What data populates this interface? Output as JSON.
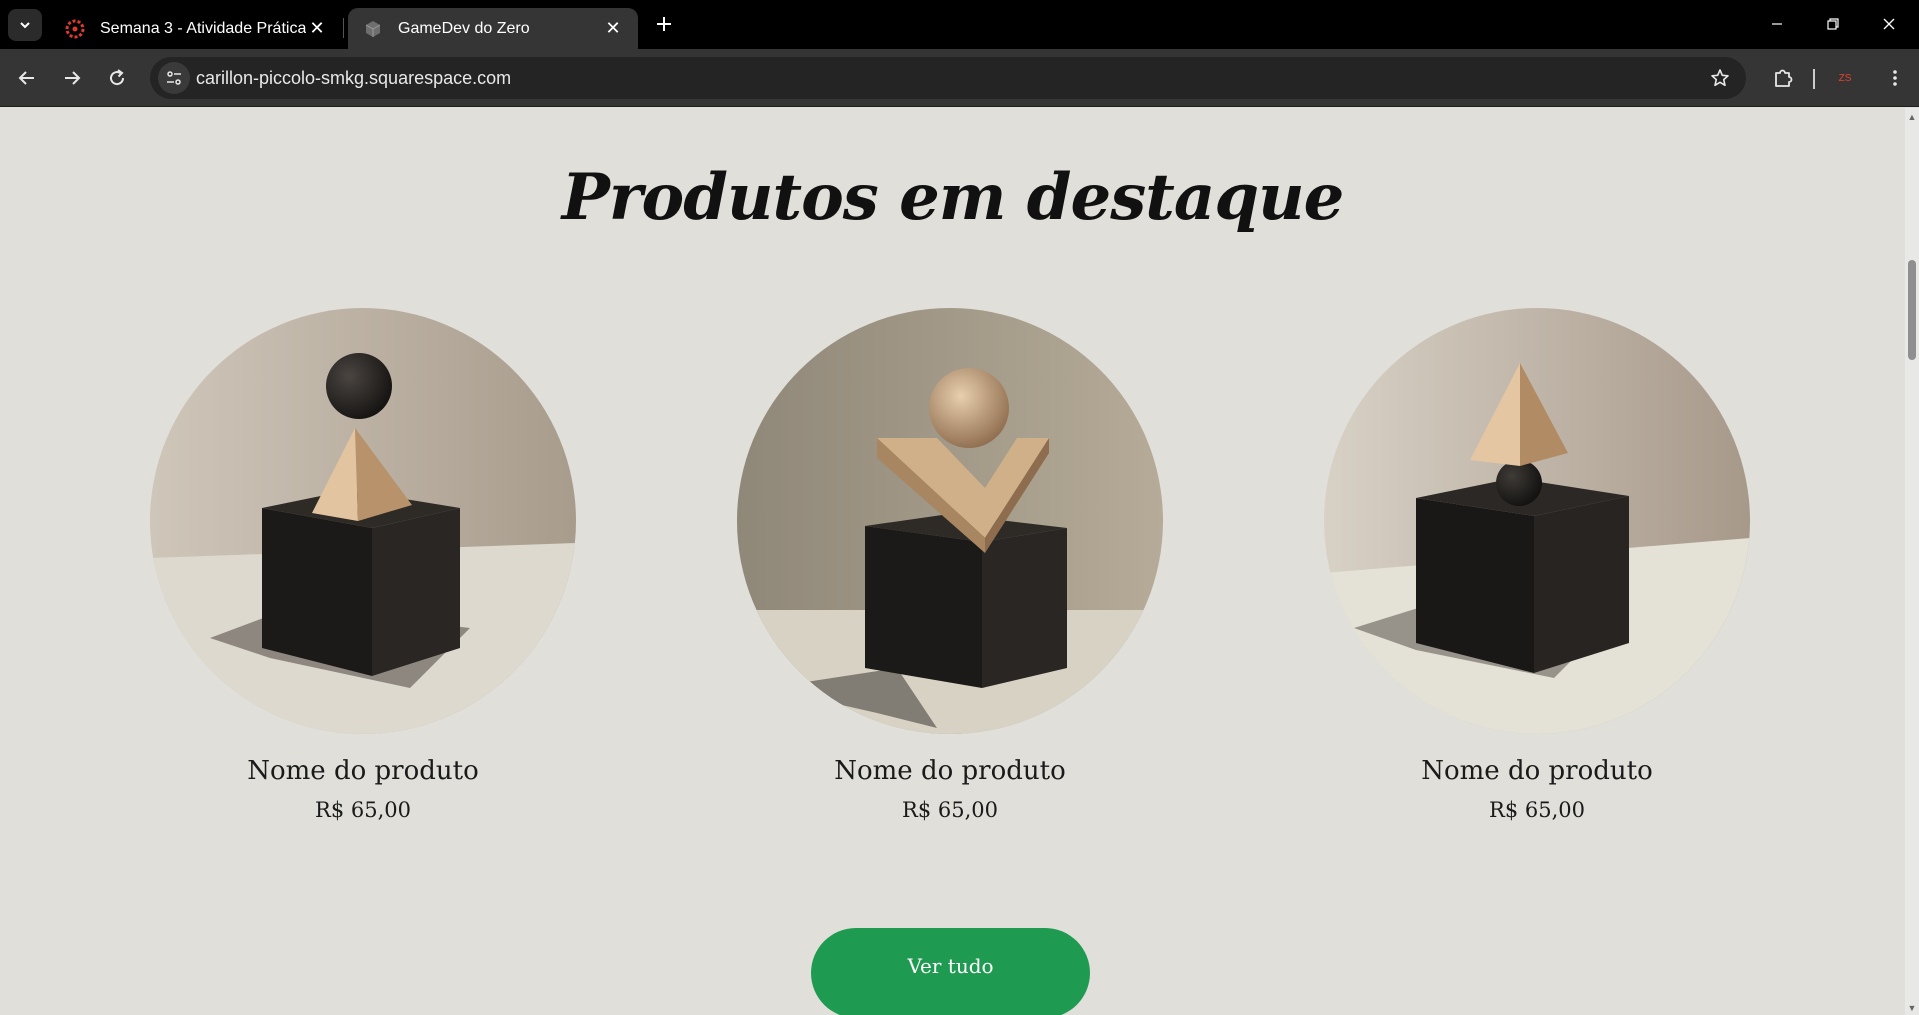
{
  "browser": {
    "tabs": [
      {
        "title": "Semana 3 - Atividade Prática",
        "favicon": "canvas-logo-icon",
        "active": false
      },
      {
        "title": "GameDev do Zero",
        "favicon": "cube-icon",
        "active": true
      }
    ],
    "url": "carillon-piccolo-smkg.squarespace.com",
    "profile_initials": "ZS"
  },
  "page": {
    "heading": "Produtos em destaque",
    "products": [
      {
        "name": "Nome do produto",
        "price": "R$ 65,00",
        "image": "sphere-above-pyramid-on-black-cube"
      },
      {
        "name": "Nome do produto",
        "price": "R$ 65,00",
        "image": "sphere-in-v-holder-on-black-cube"
      },
      {
        "name": "Nome do produto",
        "price": "R$ 65,00",
        "image": "pyramid-on-sphere-on-black-cube"
      }
    ],
    "cta_label": "Ver tudo"
  },
  "colors": {
    "page_bg": "#e0dfda",
    "cta_bg": "#1f9b51",
    "tabstrip_bg": "#000000",
    "toolbar_bg": "#353535"
  }
}
